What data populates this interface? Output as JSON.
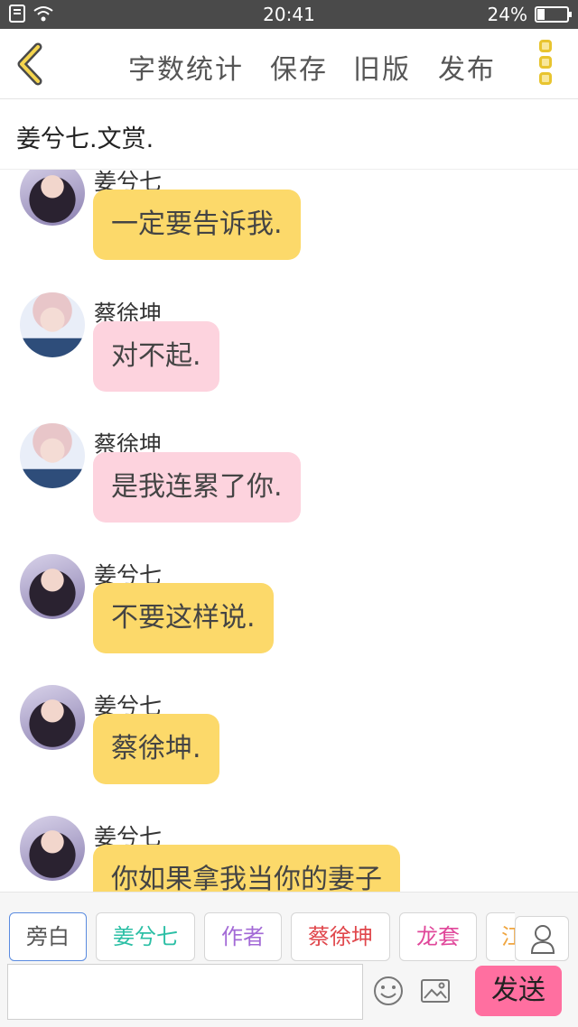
{
  "status_bar": {
    "time": "20:41",
    "battery": "24%",
    "battery_level": 0.24
  },
  "toolbar": {
    "word_count": "字数统计",
    "save": "保存",
    "old_version": "旧版",
    "publish": "发布"
  },
  "title": "姜兮七.文赏.",
  "messages": [
    {
      "name": "姜兮七",
      "text": "一定要告诉我.",
      "color": "yellow"
    },
    {
      "name": "蔡徐坤",
      "text": "对不起.",
      "color": "pink"
    },
    {
      "name": "蔡徐坤",
      "text": "是我连累了你.",
      "color": "pink"
    },
    {
      "name": "姜兮七",
      "text": "不要这样说.",
      "color": "yellow"
    },
    {
      "name": "姜兮七",
      "text": "蔡徐坤.",
      "color": "yellow"
    },
    {
      "name": "姜兮七",
      "text": "你如果拿我当你的妻子",
      "color": "yellow"
    }
  ],
  "roles": [
    {
      "label": "旁白",
      "color": "#555555"
    },
    {
      "label": "姜兮七",
      "color": "#2bbfa5"
    },
    {
      "label": "作者",
      "color": "#a36ad6"
    },
    {
      "label": "蔡徐坤",
      "color": "#e0474c"
    },
    {
      "label": "龙套",
      "color": "#e0479a"
    },
    {
      "label": "江",
      "color": "#f0a640"
    }
  ],
  "input": {
    "value": ""
  },
  "send": "发送",
  "colors": {
    "accent_yellow": "#fcd96a",
    "accent_pink": "#fdd3de",
    "send": "#ff6fa0",
    "status_bar": "#4a4a4a"
  }
}
